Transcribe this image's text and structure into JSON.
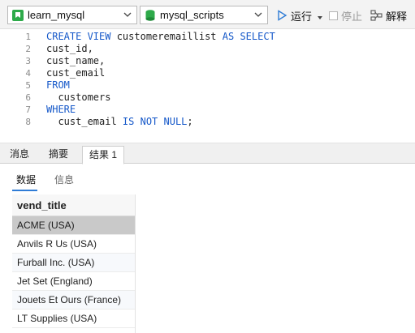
{
  "toolbar": {
    "database": "learn_mysql",
    "file": "mysql_scripts",
    "run_label": "运行",
    "stop_label": "停止",
    "explain_label": "解释",
    "colors": {
      "run_blue": "#2f7cd6",
      "db_green": "#2eaa4a"
    }
  },
  "editor": {
    "lines": [
      {
        "num": "1",
        "parts": [
          [
            "kw",
            "CREATE VIEW"
          ],
          [
            "tx",
            " customeremaillist "
          ],
          [
            "kw",
            "AS SELECT"
          ]
        ]
      },
      {
        "num": "2",
        "parts": [
          [
            "tx",
            "cust_id,"
          ]
        ]
      },
      {
        "num": "3",
        "parts": [
          [
            "tx",
            "cust_name,"
          ]
        ]
      },
      {
        "num": "4",
        "parts": [
          [
            "tx",
            "cust_email"
          ]
        ]
      },
      {
        "num": "5",
        "parts": [
          [
            "kw",
            "FROM"
          ]
        ]
      },
      {
        "num": "6",
        "parts": [
          [
            "tx",
            "  customers"
          ]
        ]
      },
      {
        "num": "7",
        "parts": [
          [
            "kw",
            "WHERE"
          ]
        ]
      },
      {
        "num": "8",
        "parts": [
          [
            "tx",
            "  cust_email "
          ],
          [
            "kw",
            "IS NOT NULL"
          ],
          [
            "tx",
            ";"
          ]
        ]
      }
    ]
  },
  "result_tabs": {
    "messages": "消息",
    "summary": "摘要",
    "result1": "结果 1"
  },
  "sub_tabs": {
    "data": "数据",
    "info": "信息"
  },
  "grid": {
    "column": "vend_title",
    "rows": [
      "ACME (USA)",
      "Anvils R Us (USA)",
      "Furball Inc. (USA)",
      "Jet Set (England)",
      "Jouets Et Ours (France)",
      "LT Supplies (USA)"
    ]
  }
}
